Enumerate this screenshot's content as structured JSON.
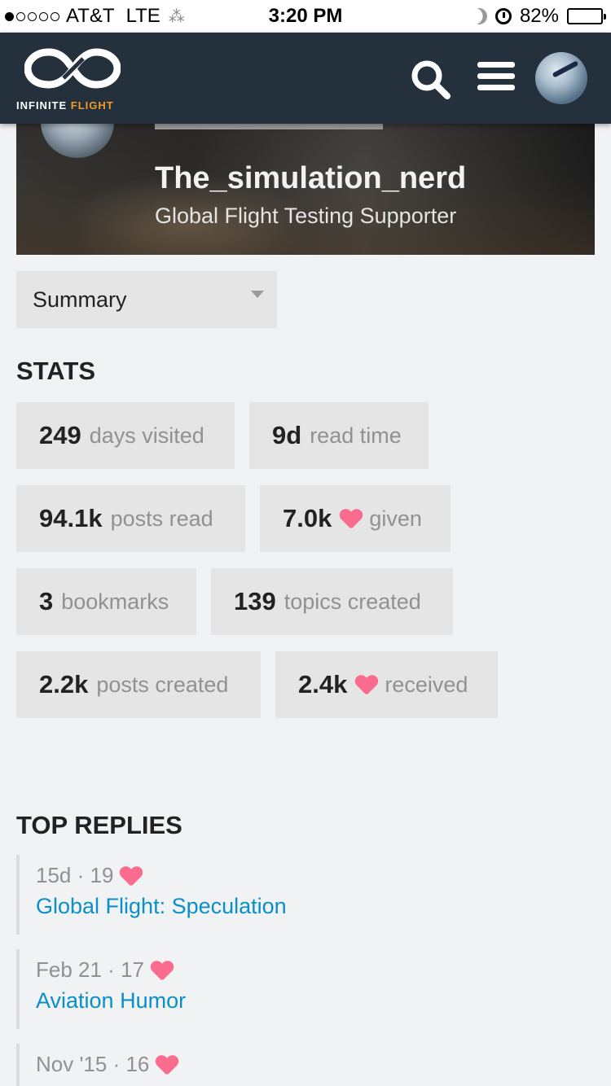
{
  "status_bar": {
    "carrier": "AT&T",
    "network": "LTE",
    "time": "3:20 PM",
    "battery_text": "82%",
    "battery_level": 0.82
  },
  "header": {
    "logo_text_part1": "INFINITE",
    "logo_text_part2": "FLIGHT",
    "brand_color": "#24303b",
    "accent_color": "#f39c2a"
  },
  "profile": {
    "username": "The_simulation_nerd",
    "title": "Global Flight Testing Supporter"
  },
  "view_select": {
    "selected": "Summary"
  },
  "stats": {
    "heading": "STATS",
    "items": [
      {
        "value": "249",
        "label": "days visited"
      },
      {
        "value": "9d",
        "label": "read time"
      },
      {
        "value": "94.1k",
        "label": "posts read"
      },
      {
        "value": "7.0k",
        "label": "given"
      },
      {
        "value": "3",
        "label": "bookmarks"
      },
      {
        "value": "139",
        "label": "topics created"
      },
      {
        "value": "2.2k",
        "label": "posts created"
      },
      {
        "value": "2.4k",
        "label": "received"
      }
    ]
  },
  "top_replies": {
    "heading": "TOP REPLIES",
    "items": [
      {
        "date": "15d",
        "likes": "19",
        "topic": "Global Flight: Speculation"
      },
      {
        "date": "Feb 21",
        "likes": "17",
        "topic": "Aviation Humor"
      },
      {
        "date": "Nov '15",
        "likes": "16",
        "topic": ""
      }
    ]
  },
  "heart_color": "#fa6c8d",
  "link_color": "#0a8fc6"
}
